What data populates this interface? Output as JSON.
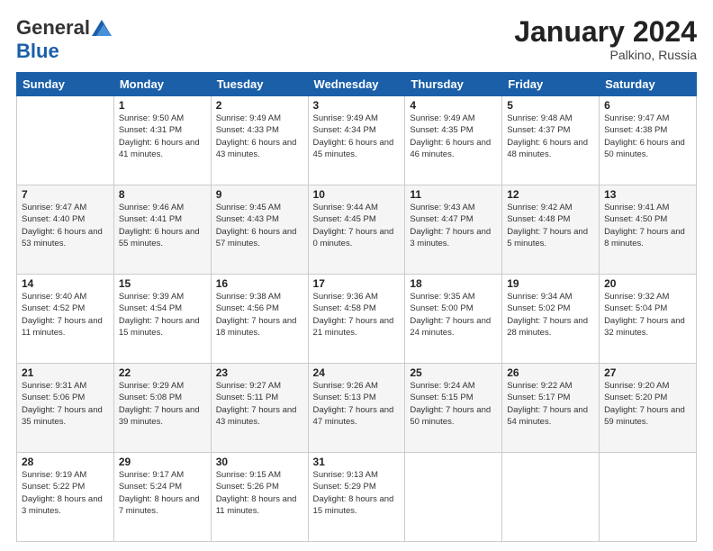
{
  "header": {
    "logo_general": "General",
    "logo_blue": "Blue",
    "month_title": "January 2024",
    "location": "Palkino, Russia"
  },
  "days_of_week": [
    "Sunday",
    "Monday",
    "Tuesday",
    "Wednesday",
    "Thursday",
    "Friday",
    "Saturday"
  ],
  "weeks": [
    [
      {
        "day": "",
        "sunrise": "",
        "sunset": "",
        "daylight": ""
      },
      {
        "day": "1",
        "sunrise": "Sunrise: 9:50 AM",
        "sunset": "Sunset: 4:31 PM",
        "daylight": "Daylight: 6 hours and 41 minutes."
      },
      {
        "day": "2",
        "sunrise": "Sunrise: 9:49 AM",
        "sunset": "Sunset: 4:33 PM",
        "daylight": "Daylight: 6 hours and 43 minutes."
      },
      {
        "day": "3",
        "sunrise": "Sunrise: 9:49 AM",
        "sunset": "Sunset: 4:34 PM",
        "daylight": "Daylight: 6 hours and 45 minutes."
      },
      {
        "day": "4",
        "sunrise": "Sunrise: 9:49 AM",
        "sunset": "Sunset: 4:35 PM",
        "daylight": "Daylight: 6 hours and 46 minutes."
      },
      {
        "day": "5",
        "sunrise": "Sunrise: 9:48 AM",
        "sunset": "Sunset: 4:37 PM",
        "daylight": "Daylight: 6 hours and 48 minutes."
      },
      {
        "day": "6",
        "sunrise": "Sunrise: 9:47 AM",
        "sunset": "Sunset: 4:38 PM",
        "daylight": "Daylight: 6 hours and 50 minutes."
      }
    ],
    [
      {
        "day": "7",
        "sunrise": "Sunrise: 9:47 AM",
        "sunset": "Sunset: 4:40 PM",
        "daylight": "Daylight: 6 hours and 53 minutes."
      },
      {
        "day": "8",
        "sunrise": "Sunrise: 9:46 AM",
        "sunset": "Sunset: 4:41 PM",
        "daylight": "Daylight: 6 hours and 55 minutes."
      },
      {
        "day": "9",
        "sunrise": "Sunrise: 9:45 AM",
        "sunset": "Sunset: 4:43 PM",
        "daylight": "Daylight: 6 hours and 57 minutes."
      },
      {
        "day": "10",
        "sunrise": "Sunrise: 9:44 AM",
        "sunset": "Sunset: 4:45 PM",
        "daylight": "Daylight: 7 hours and 0 minutes."
      },
      {
        "day": "11",
        "sunrise": "Sunrise: 9:43 AM",
        "sunset": "Sunset: 4:47 PM",
        "daylight": "Daylight: 7 hours and 3 minutes."
      },
      {
        "day": "12",
        "sunrise": "Sunrise: 9:42 AM",
        "sunset": "Sunset: 4:48 PM",
        "daylight": "Daylight: 7 hours and 5 minutes."
      },
      {
        "day": "13",
        "sunrise": "Sunrise: 9:41 AM",
        "sunset": "Sunset: 4:50 PM",
        "daylight": "Daylight: 7 hours and 8 minutes."
      }
    ],
    [
      {
        "day": "14",
        "sunrise": "Sunrise: 9:40 AM",
        "sunset": "Sunset: 4:52 PM",
        "daylight": "Daylight: 7 hours and 11 minutes."
      },
      {
        "day": "15",
        "sunrise": "Sunrise: 9:39 AM",
        "sunset": "Sunset: 4:54 PM",
        "daylight": "Daylight: 7 hours and 15 minutes."
      },
      {
        "day": "16",
        "sunrise": "Sunrise: 9:38 AM",
        "sunset": "Sunset: 4:56 PM",
        "daylight": "Daylight: 7 hours and 18 minutes."
      },
      {
        "day": "17",
        "sunrise": "Sunrise: 9:36 AM",
        "sunset": "Sunset: 4:58 PM",
        "daylight": "Daylight: 7 hours and 21 minutes."
      },
      {
        "day": "18",
        "sunrise": "Sunrise: 9:35 AM",
        "sunset": "Sunset: 5:00 PM",
        "daylight": "Daylight: 7 hours and 24 minutes."
      },
      {
        "day": "19",
        "sunrise": "Sunrise: 9:34 AM",
        "sunset": "Sunset: 5:02 PM",
        "daylight": "Daylight: 7 hours and 28 minutes."
      },
      {
        "day": "20",
        "sunrise": "Sunrise: 9:32 AM",
        "sunset": "Sunset: 5:04 PM",
        "daylight": "Daylight: 7 hours and 32 minutes."
      }
    ],
    [
      {
        "day": "21",
        "sunrise": "Sunrise: 9:31 AM",
        "sunset": "Sunset: 5:06 PM",
        "daylight": "Daylight: 7 hours and 35 minutes."
      },
      {
        "day": "22",
        "sunrise": "Sunrise: 9:29 AM",
        "sunset": "Sunset: 5:08 PM",
        "daylight": "Daylight: 7 hours and 39 minutes."
      },
      {
        "day": "23",
        "sunrise": "Sunrise: 9:27 AM",
        "sunset": "Sunset: 5:11 PM",
        "daylight": "Daylight: 7 hours and 43 minutes."
      },
      {
        "day": "24",
        "sunrise": "Sunrise: 9:26 AM",
        "sunset": "Sunset: 5:13 PM",
        "daylight": "Daylight: 7 hours and 47 minutes."
      },
      {
        "day": "25",
        "sunrise": "Sunrise: 9:24 AM",
        "sunset": "Sunset: 5:15 PM",
        "daylight": "Daylight: 7 hours and 50 minutes."
      },
      {
        "day": "26",
        "sunrise": "Sunrise: 9:22 AM",
        "sunset": "Sunset: 5:17 PM",
        "daylight": "Daylight: 7 hours and 54 minutes."
      },
      {
        "day": "27",
        "sunrise": "Sunrise: 9:20 AM",
        "sunset": "Sunset: 5:20 PM",
        "daylight": "Daylight: 7 hours and 59 minutes."
      }
    ],
    [
      {
        "day": "28",
        "sunrise": "Sunrise: 9:19 AM",
        "sunset": "Sunset: 5:22 PM",
        "daylight": "Daylight: 8 hours and 3 minutes."
      },
      {
        "day": "29",
        "sunrise": "Sunrise: 9:17 AM",
        "sunset": "Sunset: 5:24 PM",
        "daylight": "Daylight: 8 hours and 7 minutes."
      },
      {
        "day": "30",
        "sunrise": "Sunrise: 9:15 AM",
        "sunset": "Sunset: 5:26 PM",
        "daylight": "Daylight: 8 hours and 11 minutes."
      },
      {
        "day": "31",
        "sunrise": "Sunrise: 9:13 AM",
        "sunset": "Sunset: 5:29 PM",
        "daylight": "Daylight: 8 hours and 15 minutes."
      },
      {
        "day": "",
        "sunrise": "",
        "sunset": "",
        "daylight": ""
      },
      {
        "day": "",
        "sunrise": "",
        "sunset": "",
        "daylight": ""
      },
      {
        "day": "",
        "sunrise": "",
        "sunset": "",
        "daylight": ""
      }
    ]
  ]
}
